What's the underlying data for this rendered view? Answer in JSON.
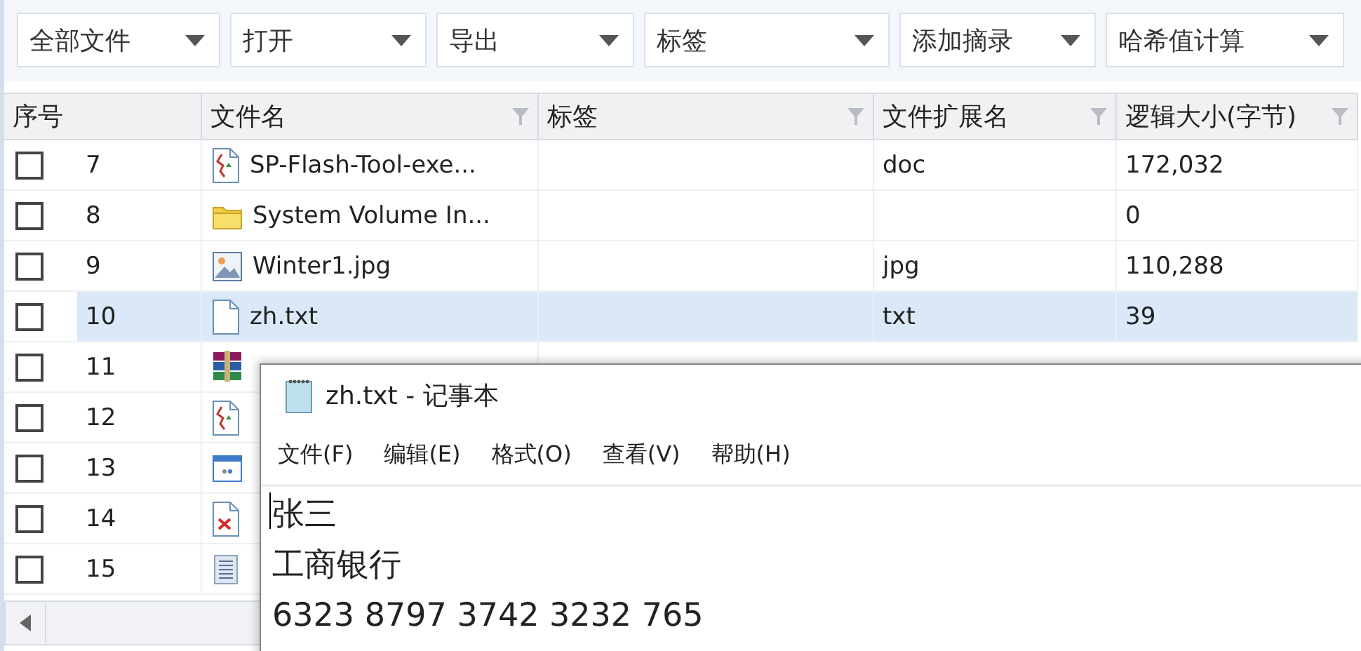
{
  "toolbar": [
    {
      "label": "全部文件"
    },
    {
      "label": "打开"
    },
    {
      "label": "导出"
    },
    {
      "label": "标签"
    },
    {
      "label": "添加摘录"
    },
    {
      "label": "哈希值计算"
    }
  ],
  "table": {
    "columns": [
      "序号",
      "文件名",
      "标签",
      "文件扩展名",
      "逻辑大小(字节)"
    ],
    "rows": [
      {
        "index": "7",
        "kind": "script",
        "name": "SP-Flash-Tool-exe...",
        "ext": "doc",
        "size": "172,032",
        "checked": false,
        "selected": false
      },
      {
        "index": "8",
        "kind": "folder",
        "name": "System Volume In...",
        "size": "0",
        "checked": false,
        "selected": false
      },
      {
        "index": "9",
        "kind": "image",
        "name": "Winter1.jpg",
        "ext": "jpg",
        "size": "110,288",
        "checked": false,
        "selected": false
      },
      {
        "index": "10",
        "kind": "text",
        "name": "zh.txt",
        "ext": "txt",
        "size": "39",
        "checked": false,
        "selected": true
      },
      {
        "index": "11",
        "kind": "archive",
        "checked": false,
        "selected": false
      },
      {
        "index": "12",
        "kind": "script",
        "checked": false,
        "selected": false
      },
      {
        "index": "13",
        "kind": "window",
        "checked": false,
        "selected": false
      },
      {
        "index": "14",
        "kind": "broken",
        "checked": false,
        "selected": false
      },
      {
        "index": "15",
        "kind": "list",
        "checked": false,
        "selected": false
      }
    ]
  },
  "notepad": {
    "title": "zh.txt - 记事本",
    "menu": [
      "文件(F)",
      "编辑(E)",
      "格式(O)",
      "查看(V)",
      "帮助(H)"
    ],
    "lines": [
      "张三",
      "工商银行",
      "6323 8797 3742 3232 765"
    ]
  }
}
